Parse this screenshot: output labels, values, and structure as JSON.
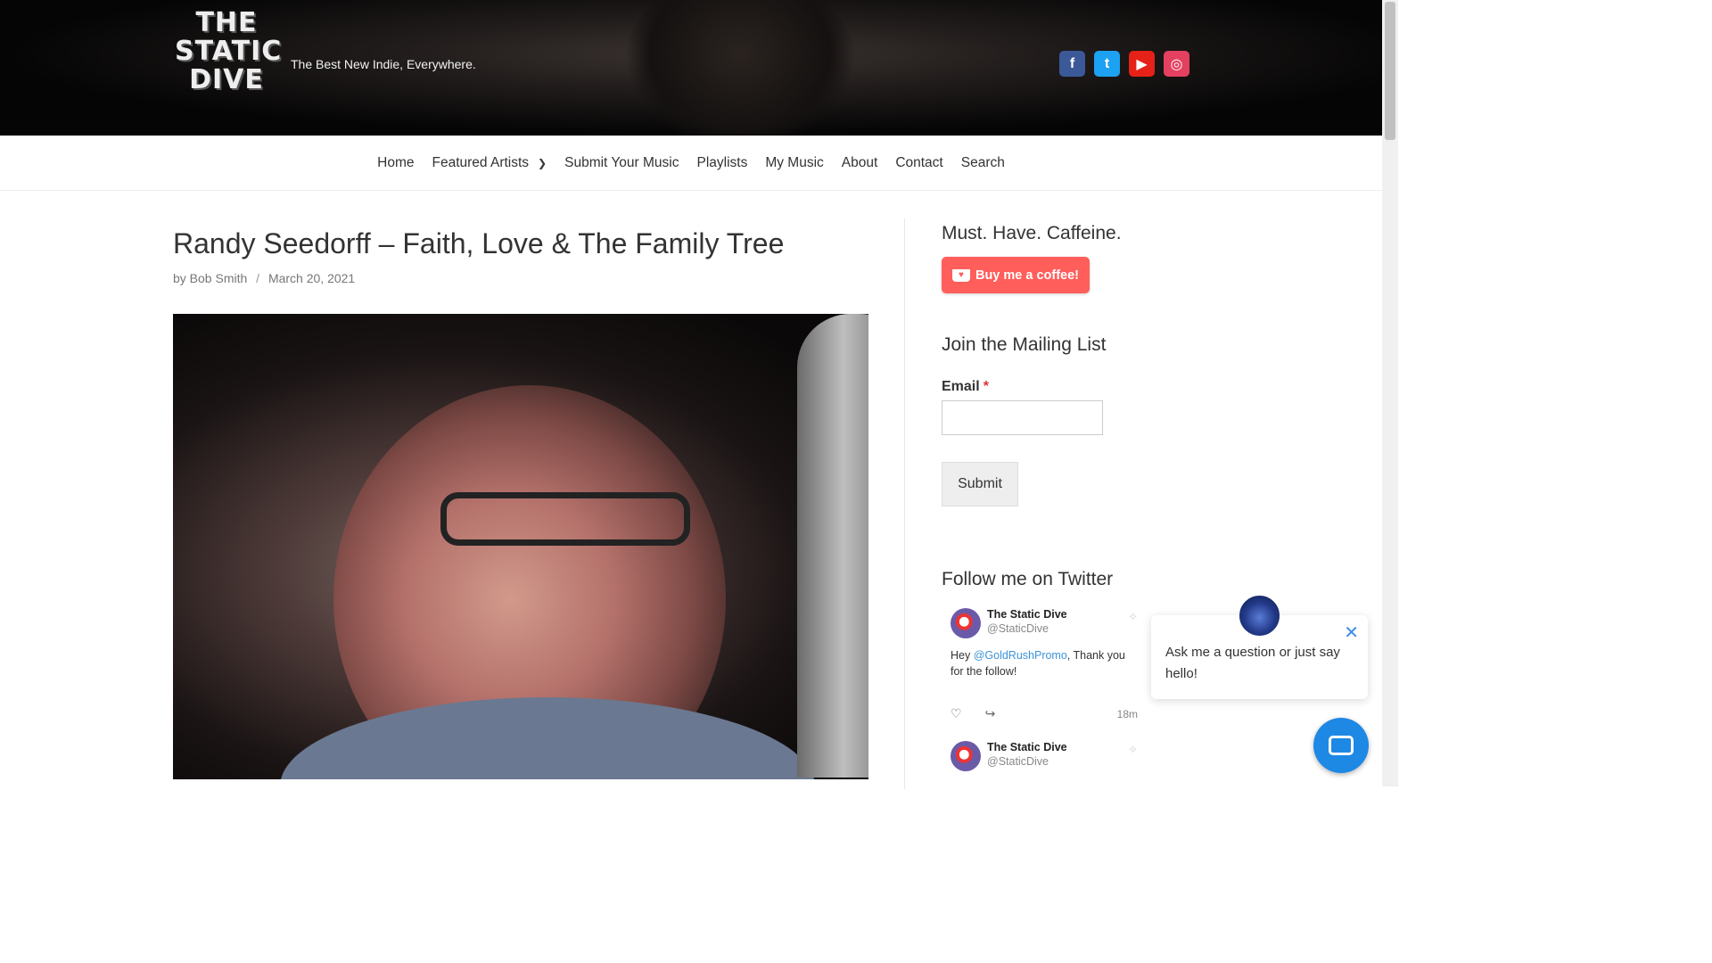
{
  "site": {
    "logo_text": "THE STATIC DIVE",
    "tagline": "The Best New Indie, Everywhere."
  },
  "social": [
    {
      "name": "facebook-icon",
      "glyph": "f"
    },
    {
      "name": "twitter-icon",
      "glyph": "t"
    },
    {
      "name": "youtube-icon",
      "glyph": "▶"
    },
    {
      "name": "instagram-icon",
      "glyph": "◎"
    }
  ],
  "nav": {
    "items": [
      "Home",
      "Featured Artists",
      "Submit Your Music",
      "Playlists",
      "My Music",
      "About",
      "Contact",
      "Search"
    ]
  },
  "post": {
    "title": "Randy Seedorff – Faith, Love & The Family Tree",
    "author": "by Bob Smith",
    "separator": "/",
    "date": "March 20, 2021"
  },
  "sidebar": {
    "caffeine_heading": "Must. Have. Caffeine.",
    "coffee_button": "Buy me a coffee!",
    "mailing_heading": "Join the Mailing List",
    "email_label": "Email",
    "required_mark": "*",
    "submit_label": "Submit",
    "twitter_heading": "Follow me on Twitter"
  },
  "tweets": [
    {
      "name": "The Static Dive",
      "handle": "@StaticDive",
      "text_pre": "Hey ",
      "mention": "@GoldRushPromo",
      "text_post": ", Thank you for the follow!",
      "time": "18m"
    },
    {
      "name": "The Static Dive",
      "handle": "@StaticDive"
    }
  ],
  "chat": {
    "message": "Ask me a question or just say hello!"
  },
  "colors": {
    "coffee": "#ff5e5b",
    "chat_button": "#1e88e5",
    "link": "#3b94d9"
  }
}
